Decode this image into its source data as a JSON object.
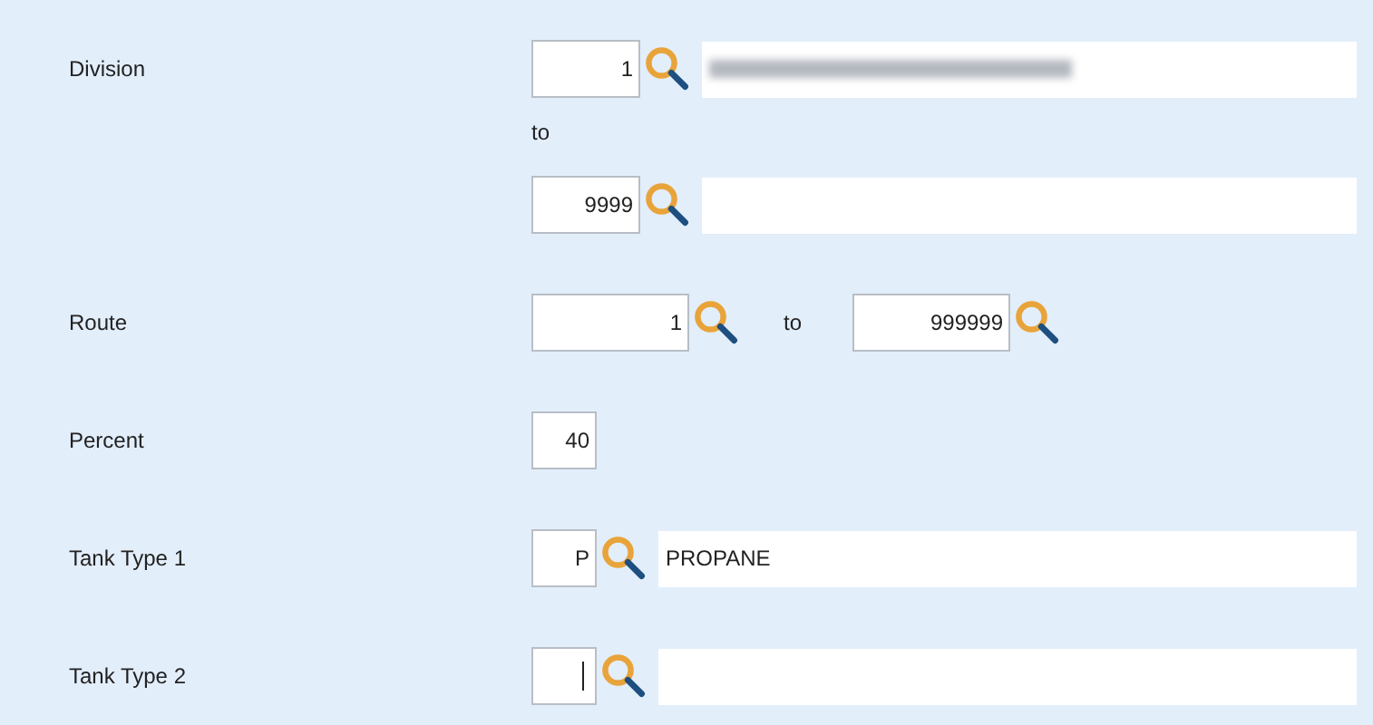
{
  "rows": [
    {
      "label": "Division",
      "lines": [
        [
          {
            "kind": "code",
            "value": "1",
            "focused": false
          },
          {
            "kind": "lookup"
          },
          {
            "kind": "desc",
            "redacted": true
          }
        ],
        [
          {
            "kind": "text",
            "value": "to"
          }
        ],
        [
          {
            "kind": "code",
            "value": "9999",
            "focused": false
          },
          {
            "kind": "lookup"
          },
          {
            "kind": "desc",
            "redacted": false
          }
        ]
      ]
    },
    {
      "label": "Route",
      "lines": [
        [
          {
            "kind": "number",
            "value": "1",
            "focused": false
          },
          {
            "kind": "lookup"
          },
          {
            "kind": "text",
            "value": "to"
          },
          {
            "kind": "number",
            "value": "999999",
            "focused": false
          },
          {
            "kind": "lookup"
          }
        ]
      ]
    },
    {
      "label": "Percent",
      "lines": [
        [
          {
            "kind": "small",
            "value": "40",
            "focused": false
          }
        ]
      ]
    },
    {
      "label": "Tank Type 1",
      "lines": [
        [
          {
            "kind": "small",
            "value": "P",
            "focused": false
          },
          {
            "kind": "lookup"
          },
          {
            "kind": "desc",
            "value": "PROPANE",
            "redacted": false
          }
        ]
      ]
    },
    {
      "label": "Tank Type 2",
      "lines": [
        [
          {
            "kind": "small",
            "focused": true
          },
          {
            "kind": "lookup"
          },
          {
            "kind": "desc",
            "redacted": false
          }
        ]
      ]
    }
  ]
}
